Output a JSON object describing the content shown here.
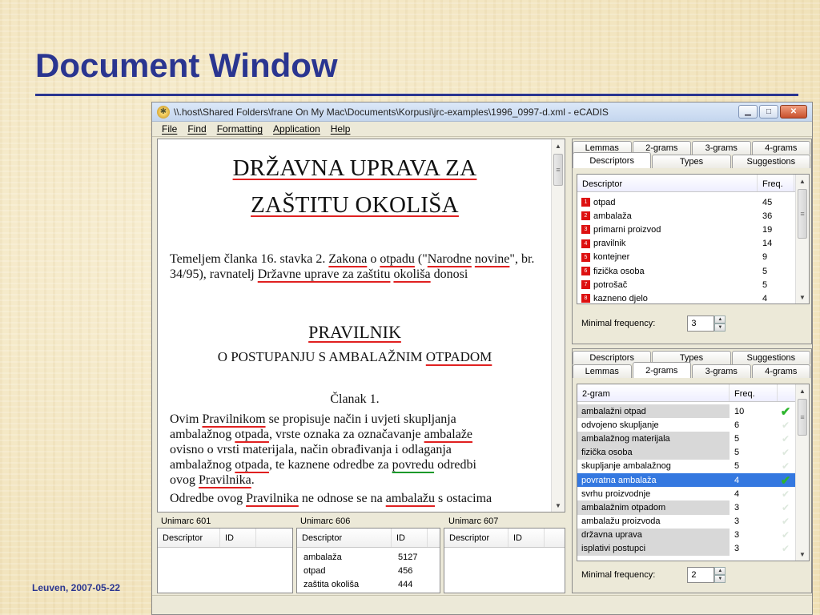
{
  "slide": {
    "title": "Document Window",
    "footer": "Leuven, 2007-05-22"
  },
  "window": {
    "title": "\\\\.host\\Shared Folders\\frane On My Mac\\Documents\\Korpusi\\jrc-examples\\1996_0997-d.xml - eCADIS",
    "menu": [
      "File",
      "Find",
      "Formatting",
      "Application",
      "Help"
    ]
  },
  "document": {
    "heading_line1": "DRŽAVNA UPRAVA ZA",
    "heading_line2": "ZAŠTITU OKOLIŠA",
    "intro": {
      "t1": "Temeljem članka 16. stavka 2. ",
      "zakona": "Zakona",
      "t2": " o ",
      "otpadu": "otpadu",
      "t3": " (\"",
      "narodne": "Narodne",
      "novine": "novine",
      "t4": "\", br. 34/95), ravnatelj ",
      "drzavne": "Državne uprave za zaštitu",
      "okolisa": "okoliša",
      "t5": " donosi"
    },
    "pravilnik": "PRAVILNIK",
    "subtitle_a": "O POSTUPANJU S AMBALAŽNIM ",
    "subtitle_b": "OTPADOM",
    "clanak": "Članak 1.",
    "body": {
      "a1": "Ovim ",
      "a2": "Pravilnikom",
      "a3": " se propisuje način i uvjeti skupljanja",
      "b1": "ambalažnog ",
      "b2": "otpada",
      "b3": ", vrste oznaka za označavanje ",
      "b4": "ambalaže",
      "c1": "ovisno o vrsti materijala, način obrađivanja i odlaganja",
      "d1": "ambalažnog ",
      "d2": "otpada",
      "d3": ", te kaznene odredbe za ",
      "d4": "povredu",
      "d5": " odredbi",
      "e1": "ovog ",
      "e2": "Pravilnika",
      "e3": ".",
      "f1": "Odredbe ovog ",
      "f2": "Pravilnika",
      "f3": " ne odnose se na ",
      "f4": "ambalažu",
      "f5": " s ostacima"
    }
  },
  "unimarc": [
    {
      "label": "Unimarc 601",
      "col1": "Descriptor",
      "col2": "ID",
      "rows": []
    },
    {
      "label": "Unimarc 606",
      "col1": "Descriptor",
      "col2": "ID",
      "rows": [
        {
          "d": "ambalaža",
          "id": "5127"
        },
        {
          "d": "otpad",
          "id": "456"
        },
        {
          "d": "zaštita okoliša",
          "id": "444"
        }
      ]
    },
    {
      "label": "Unimarc 607",
      "col1": "Descriptor",
      "col2": "ID",
      "rows": []
    }
  ],
  "top_panel": {
    "tabs_row1": [
      "Lemmas",
      "2-grams",
      "3-grams",
      "4-grams"
    ],
    "tabs_row2": [
      "Descriptors",
      "Types",
      "Suggestions"
    ],
    "selected_tab": "Descriptors",
    "col1": "Descriptor",
    "col2": "Freq.",
    "rows": [
      {
        "n": "1",
        "t": "otpad",
        "f": "45"
      },
      {
        "n": "2",
        "t": "ambalaža",
        "f": "36"
      },
      {
        "n": "3",
        "t": "primarni proizvod",
        "f": "19"
      },
      {
        "n": "4",
        "t": "pravilnik",
        "f": "14"
      },
      {
        "n": "5",
        "t": "kontejner",
        "f": "9"
      },
      {
        "n": "6",
        "t": "fizička osoba",
        "f": "5"
      },
      {
        "n": "7",
        "t": "potrošač",
        "f": "5"
      },
      {
        "n": "8",
        "t": "kazneno djelo",
        "f": "4"
      }
    ],
    "minfreq_label": "Minimal frequency:",
    "minfreq_value": "3"
  },
  "bottom_panel": {
    "tabs_row1": [
      "Descriptors",
      "Types",
      "Suggestions"
    ],
    "tabs_row2": [
      "Lemmas",
      "2-grams",
      "3-grams",
      "4-grams"
    ],
    "selected_tab": "2-grams",
    "col1": "2-gram",
    "col2": "Freq.",
    "rows": [
      {
        "t": "ambalažni otpad",
        "f": "10",
        "shade": true,
        "check": true
      },
      {
        "t": "odvojeno skupljanje",
        "f": "6",
        "shade": false,
        "check": false
      },
      {
        "t": "ambalažnog materijala",
        "f": "5",
        "shade": true,
        "check": false
      },
      {
        "t": "fizička osoba",
        "f": "5",
        "shade": true,
        "check": false
      },
      {
        "t": "skupljanje ambalažnog",
        "f": "5",
        "shade": false,
        "check": false
      },
      {
        "t": "povratna ambalaža",
        "f": "4",
        "shade": false,
        "check": true,
        "sel": true
      },
      {
        "t": "svrhu proizvodnje",
        "f": "4",
        "shade": false,
        "check": false
      },
      {
        "t": "ambalažnim otpadom",
        "f": "3",
        "shade": true,
        "check": false
      },
      {
        "t": "ambalažu proizvoda",
        "f": "3",
        "shade": false,
        "check": false
      },
      {
        "t": "državna uprava",
        "f": "3",
        "shade": true,
        "check": false
      },
      {
        "t": "isplativi postupci",
        "f": "3",
        "shade": true,
        "check": false
      }
    ],
    "minfreq_label": "Minimal frequency:",
    "minfreq_value": "2"
  }
}
